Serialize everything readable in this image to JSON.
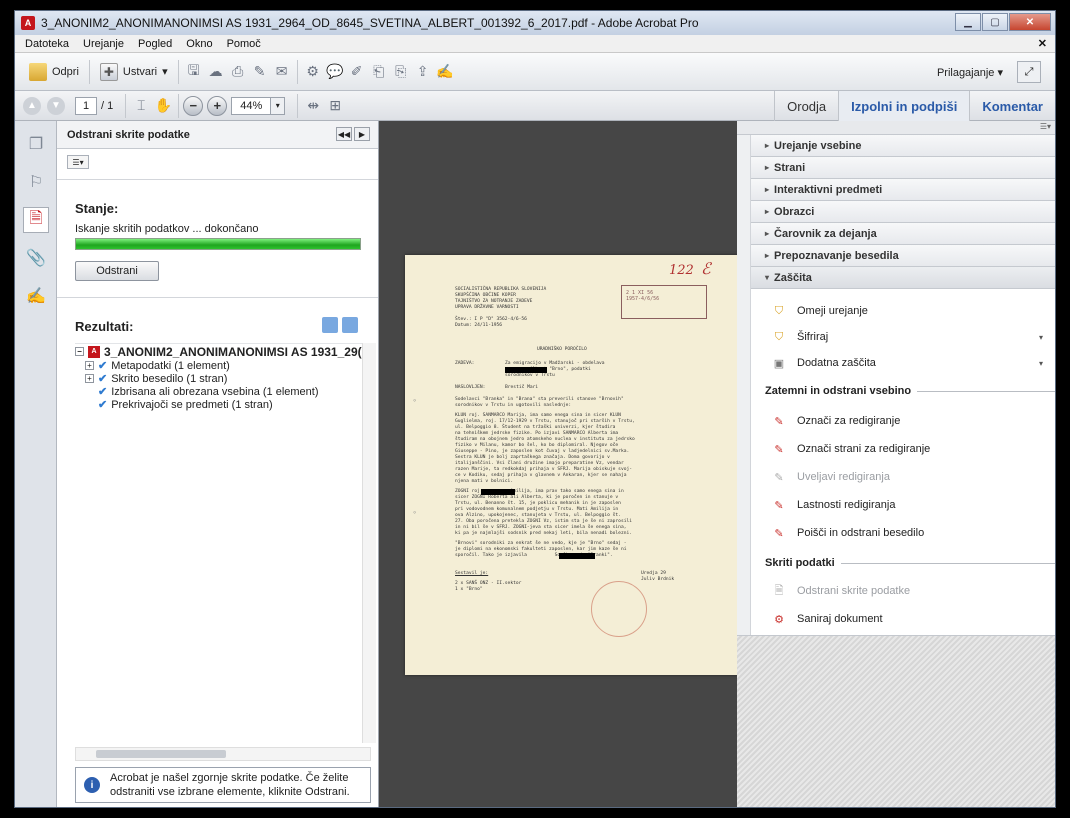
{
  "window": {
    "title": "3_ANONIM2_ANONIMANONIMSI AS 1931_2964_OD_8645_SVETINA_ALBERT_001392_6_2017.pdf - Adobe Acrobat Pro",
    "close": "✕"
  },
  "menu": [
    "Datoteka",
    "Urejanje",
    "Pogled",
    "Okno",
    "Pomoč"
  ],
  "toolbar": {
    "open_label": "Odpri",
    "create_label": "Ustvari",
    "customize_label": "Prilagajanje",
    "page_current": "1",
    "page_total": "/ 1",
    "zoom": "44%"
  },
  "tabs": {
    "tools": "Orodja",
    "fill_sign": "Izpolni in podpiši",
    "comment": "Komentar"
  },
  "left_panel": {
    "title": "Odstrani skrite podatke",
    "status_heading": "Stanje:",
    "status_text": "Iskanje skritih podatkov ... dokončano",
    "progress": 100,
    "remove_button": "Odstrani",
    "results_heading": "Rezultati:",
    "tree": {
      "root": "3_ANONIM2_ANONIMANONIMSI AS 1931_29(",
      "children": [
        "Metapodatki (1 element)",
        "Skrito besedilo (1 stran)",
        "Izbrisana ali obrezana vsebina (1 element)",
        "Prekrivajoči se predmeti (1 stran)"
      ]
    },
    "info_text": "Acrobat je našel zgornje skrite podatke. Če želite odstraniti vse izbrane elemente, kliknite Odstrani."
  },
  "document": {
    "page_mark": "122",
    "header_block": "SOCIALISTIČNA REPUBLIKA SLOVENIJA\nSKUPŠČINA OBČINE KOPER\nTAJNIŠTVO ZA NOTRANJE ZADEVE\nUPRAVA DRŽAVNE VARNOSTI",
    "ref_line": "Štev.: I P \"D\" 3562-4/6-56\nDatum: 24/11-1956",
    "doc_title": "URADNIŠKO POROČILO",
    "zadeva_label": "ZADEVA:",
    "zadeva_text": "Za emigracijo v Madžarski - obdelava\n         Albert \"Brno\", podatki\nsorodnikov v Trstu",
    "naslov_label": "NASLOVLJEN:",
    "naslov_text": "Brestič Mari",
    "para1": "Sodelavci \"Branka\" in \"Brana\" sta preverili stanove \"Brnovih\"\nsorodnikov v Trstu in ugotovili naslednje:",
    "para2": "KLUN roj. SANMARCO Marija, ima samo enega sina in sicer KLUN\nGuglielma, roj. 17/12-1929 v Trstu, stanujoč pri starših v Trstu,\nul. Belpoggio 8. Študent na tržaški univerzi, kjer študira\nna tehniškem jedrske fizike. Po izjavi SANMARCO Alberta ima\nštudiram na obojnem jedro atomskeho nuclea v institutu za jedrsko\nfiziko v Milanu, kamor bo šel, ko bo diplomiral. Njegov oče\nGiuseppe - Pino, je zaposlen kot čuvaj v ladjedelnici sv.Marka.\nSestra KLUN je bolj zaprtaškega značaja. Doma govorijo v\nitalijanščini. Vsi člani družine imajo preparatine Vz, vendar\nrazen Marije, ta redkokdaj prihaja v SFRJ. Marija obiskuje svoj-\nce v Kodiku, sedaj prihaja v glavnem v Ankaran, kjer se nahaja\nnjena mati v bolnici.",
    "para3": "ZOGNI roj.          Amilija, ima prav tako samo enega sina in\nsicer ZOGNI Roberta ali Alberta, ki je poročen in stanuje v\nTrstu, ul. Benanno št. 15, je poklicu mehanik in je zaposlen\npri vodovodnem komunalnem podjetju v Trstu. Mati Amilija in\nova Alzino, upokojenec, stanujeta v Trstu, ul. Belpoggio št.\n27. Oba poročena pretekla ZOGNI Vz, istim sta je še ni zaprosili\nin ni bil še v SFRJ. ZOGNI-jeva sta sicer imela še enega sina,\nki pa je najmlajši sodsnik pred nekaj leti, bila nenadi bolezni.",
    "para4": "\"Brnovi\" sorodniki za enkrat še ne vedo, kje je \"Brno\" sedaj -\nje diplomi na ekonomski fakulteti zaposlen, kar jim kaze še ni\nsporočil. Tako je izjavila          Sončka sod. \"Branki\".",
    "sestavil_label": "Sestavil je:",
    "dist": "2 x SANŠ ONZ - II.sektor\n1 x \"Brno\"",
    "signature": "Uredja 29\nJuliv Brdnik",
    "stamp": "2 1 XI 56\n1957-4/6/56"
  },
  "right_panel": {
    "sections": [
      "Urejanje vsebine",
      "Strani",
      "Interaktivni predmeti",
      "Obrazci",
      "Čarovnik za dejanja",
      "Prepoznavanje besedila",
      "Zaščita"
    ],
    "protection_items": [
      "Omeji urejanje",
      "Šifriraj",
      "Dodatna zaščita"
    ],
    "redact_heading": "Zatemni in odstrani vsebino",
    "redact_items": [
      "Označi za redigiranje",
      "Označi strani za redigiranje",
      "Uveljavi redigiranja",
      "Lastnosti redigiranja",
      "Poišči in odstrani besedilo"
    ],
    "hidden_heading": "Skriti podatki",
    "hidden_items": [
      "Odstrani skrite podatke",
      "Saniraj dokument"
    ]
  },
  "colors": {
    "progress": "#2ec22e",
    "accent_blue": "#2a5aa8",
    "redact_red": "#c9302c"
  }
}
